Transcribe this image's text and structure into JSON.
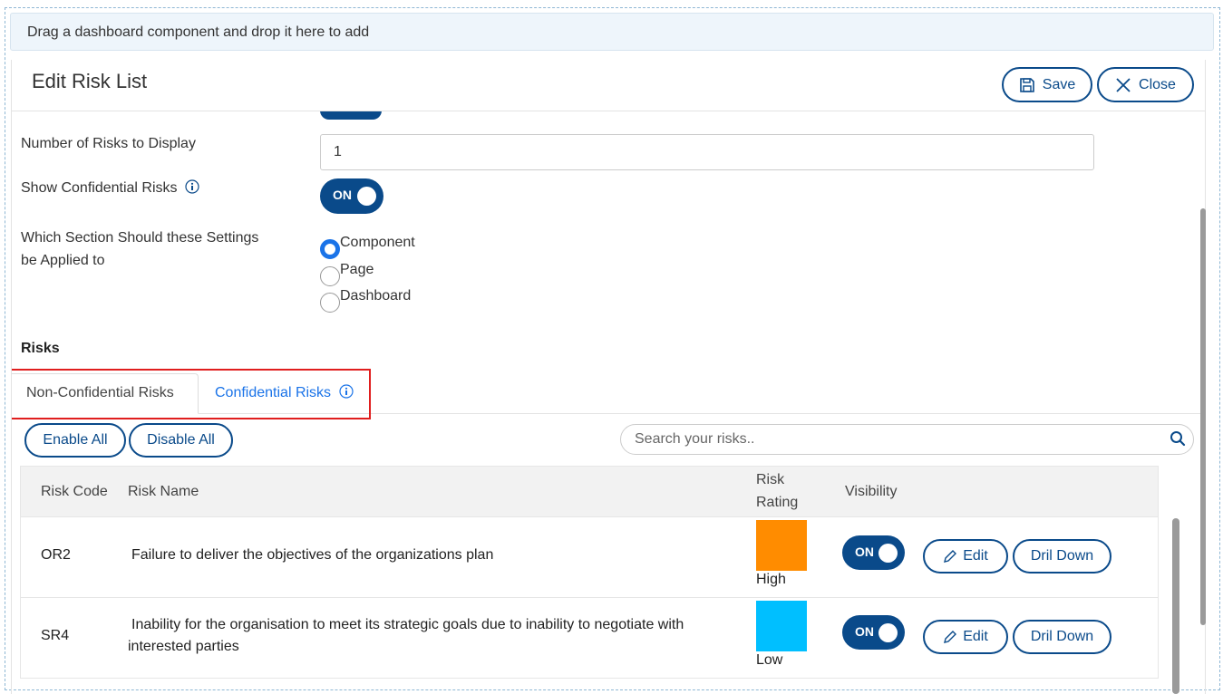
{
  "drop_banner": "Drag a dashboard component and drop it here to add",
  "header": {
    "title": "Edit Risk List",
    "save_label": "Save",
    "close_label": "Close"
  },
  "form": {
    "num_risks_label": "Number of Risks to Display",
    "num_risks_value": "1",
    "show_confidential_label": "Show Confidential Risks",
    "show_confidential_toggle": "ON",
    "apply_section_label_line1": "Which Section Should these Settings",
    "apply_section_label_line2": "be Applied to",
    "apply_options": [
      "Component",
      "Page",
      "Dashboard"
    ],
    "apply_selected": "Component"
  },
  "risks": {
    "section_title": "Risks",
    "tabs": [
      "Non-Confidential Risks",
      "Confidential Risks"
    ],
    "active_tab": "Non-Confidential Risks",
    "enable_all_label": "Enable All",
    "disable_all_label": "Disable All",
    "search_placeholder": "Search your risks..",
    "columns": {
      "code": "Risk Code",
      "name": "Risk Name",
      "rating_line1": "Risk",
      "rating_line2": "Rating",
      "visibility": "Visibility"
    },
    "rows": [
      {
        "code": "OR2",
        "name": "Failure to deliver the objectives of the organizations plan",
        "rating": "High",
        "rating_color": "#ff8c00",
        "visibility": "ON",
        "edit_label": "Edit",
        "drill_label": "Dril Down"
      },
      {
        "code": "SR4",
        "name": "Inability for the organisation to meet its strategic goals due to inability to negotiate with interested parties",
        "rating": "Low",
        "rating_color": "#00bfff",
        "visibility": "ON",
        "edit_label": "Edit",
        "drill_label": "Dril Down"
      }
    ]
  },
  "colors": {
    "primary": "#0a4a8a",
    "link": "#1a73e8",
    "highlight": "#e01e1e"
  }
}
